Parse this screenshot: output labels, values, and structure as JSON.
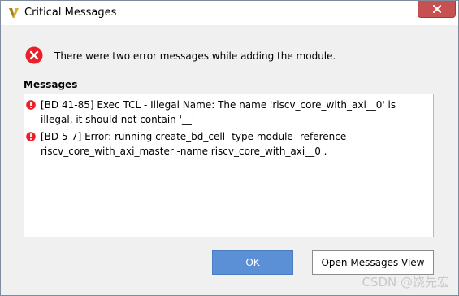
{
  "window": {
    "title": "Critical Messages",
    "close_icon": "close-icon",
    "app_icon": "vivado-logo-icon"
  },
  "header": {
    "icon": "error-icon",
    "text": "There were two error messages while adding the module."
  },
  "messages": {
    "label": "Messages",
    "items": [
      {
        "icon": "error-bullet-icon",
        "text": "[BD 41-85] Exec TCL - Illegal Name: The name 'riscv_core_with_axi__0' is illegal, it should not contain '__'"
      },
      {
        "icon": "error-bullet-icon",
        "text": "[BD 5-7] Error: running create_bd_cell  -type module -reference riscv_core_with_axi_master -name riscv_core_with_axi__0 ."
      }
    ]
  },
  "buttons": {
    "ok": "OK",
    "open_view": "Open Messages View"
  },
  "watermark": "CSDN @饶先宏",
  "colors": {
    "error_red": "#e8202a",
    "ok_button": "#5b8fd6",
    "close_button": "#c75050"
  }
}
